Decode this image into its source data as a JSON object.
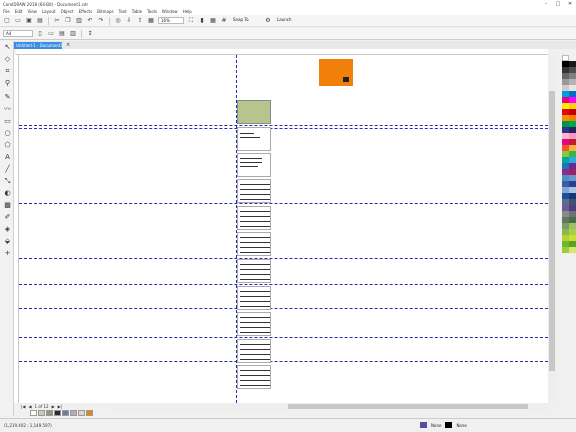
{
  "app": {
    "title": "CorelDRAW 2018 (64-Bit) - Document1.cdr",
    "window_controls": [
      "–",
      "□",
      "✕"
    ]
  },
  "menubar": {
    "items": [
      "File",
      "Edit",
      "View",
      "Layout",
      "Object",
      "Effects",
      "Bitmaps",
      "Text",
      "Table",
      "Tools",
      "Window",
      "Help"
    ]
  },
  "toolbar": {
    "zoom_value": "16%",
    "snap_label": "Snap To",
    "launch_label": "Launch"
  },
  "propbar": {
    "units_value": "A4"
  },
  "document": {
    "tab_label": "Untitled-1 - Document1",
    "tab_close": "×"
  },
  "pagenav": {
    "labels": [
      "|◀",
      "◀",
      "1 of 12",
      "▶",
      "▶|"
    ]
  },
  "status": {
    "coords": "(1,219.402 ; 1,149.597)",
    "fill_label": "None",
    "outline_label": "None"
  },
  "colors": {
    "guide": "#1f2fb0",
    "accent_tab": "#3a8de0",
    "orange_object": "#f0800a",
    "cover_page": "#b8c48e"
  },
  "icons": {
    "tools": [
      "pick-tool-icon",
      "shape-tool-icon",
      "crop-tool-icon",
      "zoom-tool-icon",
      "freehand-tool-icon",
      "artistic-media-icon",
      "rectangle-tool-icon",
      "ellipse-tool-icon",
      "polygon-tool-icon",
      "text-tool-icon",
      "parallel-dimension-icon",
      "connector-icon",
      "blend-icon",
      "transparency-icon",
      "eyedropper-icon",
      "interactive-fill-icon",
      "smart-fill-icon"
    ]
  }
}
